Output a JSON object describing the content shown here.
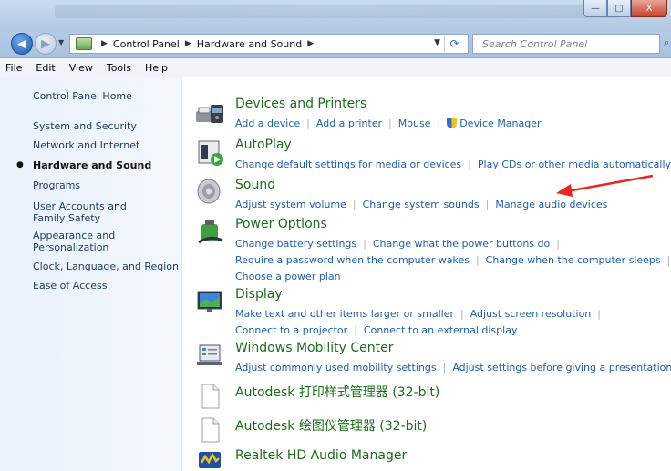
{
  "window": {
    "minimize_label": "—",
    "maximize_label": "▢",
    "close_label": "X"
  },
  "address_bar": {
    "crumbs": [
      "Control Panel",
      "Hardware and Sound"
    ],
    "search_placeholder": "Search Control Panel"
  },
  "menu": [
    "File",
    "Edit",
    "View",
    "Tools",
    "Help"
  ],
  "sidebar": {
    "items": [
      {
        "label": "Control Panel Home",
        "active": false
      },
      {
        "label": "System and Security",
        "active": false
      },
      {
        "label": "Network and Internet",
        "active": false
      },
      {
        "label": "Hardware and Sound",
        "active": true
      },
      {
        "label": "Programs",
        "active": false
      },
      {
        "label": "User Accounts and Family Safety",
        "active": false
      },
      {
        "label": "Appearance and Personalization",
        "active": false
      },
      {
        "label": "Clock, Language, and Region",
        "active": false
      },
      {
        "label": "Ease of Access",
        "active": false
      }
    ]
  },
  "categories": {
    "devices": {
      "title": "Devices and Printers",
      "links": [
        "Add a device",
        "Add a printer",
        "Mouse",
        "Device Manager"
      ]
    },
    "autoplay": {
      "title": "AutoPlay",
      "links": [
        "Change default settings for media or devices",
        "Play CDs or other media automatically"
      ]
    },
    "sound": {
      "title": "Sound",
      "links": [
        "Adjust system volume",
        "Change system sounds",
        "Manage audio devices"
      ]
    },
    "power": {
      "title": "Power Options",
      "links": [
        "Change battery settings",
        "Change what the power buttons do",
        "Require a password when the computer wakes",
        "Change when the computer sleeps",
        "Choose a power plan"
      ]
    },
    "display": {
      "title": "Display",
      "links": [
        "Make text and other items larger or smaller",
        "Adjust screen resolution",
        "Connect to a projector",
        "Connect to an external display"
      ]
    },
    "mobility": {
      "title": "Windows Mobility Center",
      "links": [
        "Adjust commonly used mobility settings",
        "Adjust settings before giving a presentation"
      ]
    },
    "autodesk_print": {
      "title": "Autodesk 打印样式管理器 (32-bit)"
    },
    "autodesk_plot": {
      "title": "Autodesk 绘图仪管理器 (32-bit)"
    },
    "realtek": {
      "title": "Realtek HD Audio Manager"
    }
  },
  "colors": {
    "link": "#1e5eb0",
    "category_title": "#1a6e1a",
    "annotation_arrow": "#e8261f"
  }
}
